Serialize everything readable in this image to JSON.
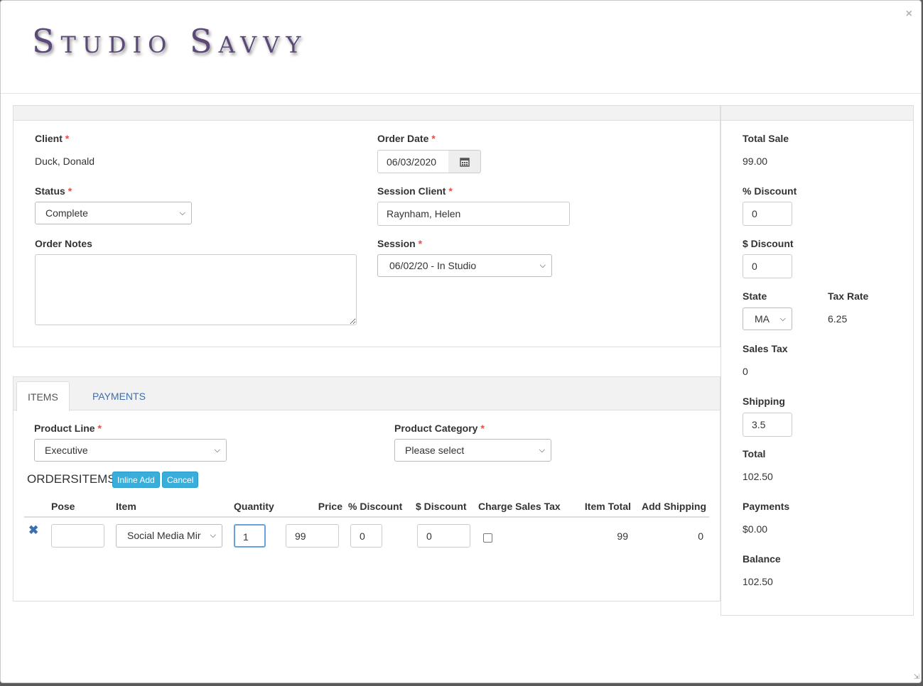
{
  "header": {
    "logo_text": "Studio Savvy",
    "close": "×"
  },
  "order": {
    "client_label": "Client",
    "client_value": "Duck, Donald",
    "status_label": "Status",
    "status_value": "Complete",
    "notes_label": "Order Notes",
    "notes_value": "",
    "order_date_label": "Order Date",
    "order_date_value": "06/03/2020",
    "session_client_label": "Session Client",
    "session_client_value": "Raynham, Helen",
    "session_label": "Session",
    "session_value": "06/02/20 - In Studio",
    "required": "*"
  },
  "tabs": [
    {
      "label": "ITEMS",
      "active": true
    },
    {
      "label": "PAYMENTS",
      "active": false
    }
  ],
  "items_tab": {
    "product_line_label": "Product Line",
    "product_line_value": "Executive",
    "product_category_label": "Product Category",
    "product_category_value": "Please select",
    "section_title": "ORDERSITEMS",
    "inline_add_label": "Inline Add",
    "cancel_label": "Cancel",
    "columns": [
      "Pose",
      "Item",
      "Quantity",
      "Price",
      "% Discount",
      "$ Discount",
      "Charge Sales Tax",
      "Item Total",
      "Add Shipping"
    ],
    "rows": [
      {
        "pose": "",
        "item": "Social Media Mir",
        "quantity": "1",
        "price": "99",
        "pct_discount": "0",
        "dollar_discount": "0",
        "charge_sales_tax": false,
        "item_total": "99",
        "add_shipping": "0"
      }
    ]
  },
  "summary": {
    "total_sale_label": "Total Sale",
    "total_sale_value": "99.00",
    "pct_discount_label": "% Discount",
    "pct_discount_value": "0",
    "dollar_discount_label": "$ Discount",
    "dollar_discount_value": "0",
    "state_label": "State",
    "state_value": "MA",
    "tax_rate_label": "Tax Rate",
    "tax_rate_value": "6.25",
    "sales_tax_label": "Sales Tax",
    "sales_tax_value": "0",
    "shipping_label": "Shipping",
    "shipping_value": "3.5",
    "total_label": "Total",
    "total_value": "102.50",
    "payments_label": "Payments",
    "payments_value": "$0.00",
    "balance_label": "Balance",
    "balance_value": "102.50"
  },
  "icons": {
    "calendar": "calendar-icon",
    "delete": "remove-icon",
    "chevron": "chevron-down-icon"
  },
  "colors": {
    "accent": "#3aaedb",
    "link": "#3a6fb0",
    "required": "#d9534f",
    "logo": "#5b4a78"
  }
}
